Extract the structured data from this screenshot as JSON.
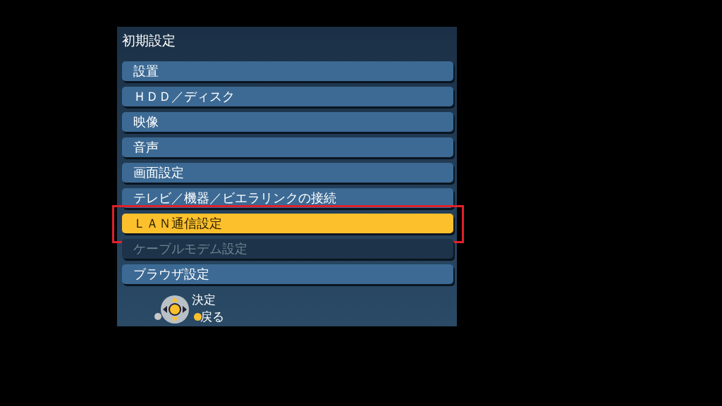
{
  "menu": {
    "title": "初期設定",
    "items": [
      {
        "label": "設置",
        "selected": false,
        "disabled": false
      },
      {
        "label": "ＨＤＤ／ディスク",
        "selected": false,
        "disabled": false
      },
      {
        "label": "映像",
        "selected": false,
        "disabled": false
      },
      {
        "label": "音声",
        "selected": false,
        "disabled": false
      },
      {
        "label": "画面設定",
        "selected": false,
        "disabled": false
      },
      {
        "label": "テレビ／機器／ビエラリンクの接続",
        "selected": false,
        "disabled": false
      },
      {
        "label": "ＬＡＮ通信設定",
        "selected": true,
        "disabled": false
      },
      {
        "label": "ケーブルモデム設定",
        "selected": false,
        "disabled": true
      },
      {
        "label": "ブラウザ設定",
        "selected": false,
        "disabled": false
      }
    ]
  },
  "hints": [
    {
      "label": "決定"
    },
    {
      "label": "戻る"
    }
  ]
}
